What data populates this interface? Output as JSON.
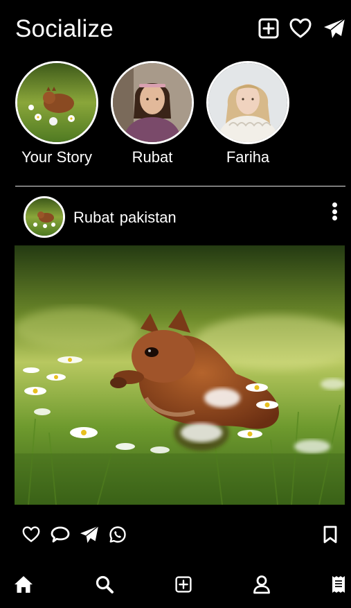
{
  "app": {
    "title": "Socialize"
  },
  "header_icons": [
    "add-post-icon",
    "heart-icon",
    "send-icon"
  ],
  "stories": [
    {
      "name": "Your Story",
      "image": "squirrel-photo"
    },
    {
      "name": "Rubat",
      "image": "girl-portrait-photo"
    },
    {
      "name": "Fariha",
      "image": "woman-portrait-photo"
    }
  ],
  "post": {
    "username": "Rubat",
    "location": "pakistan",
    "image": "squirrel-in-daisies-photo"
  },
  "post_actions": [
    "heart-icon",
    "comment-icon",
    "send-icon",
    "whatsapp-icon",
    "bookmark-icon"
  ],
  "bottom_nav": [
    "home-icon",
    "search-icon",
    "add-post-icon",
    "profile-icon",
    "receipt-icon"
  ],
  "colors": {
    "background": "#000000",
    "foreground": "#ffffff",
    "divider": "#e6e6e6"
  }
}
